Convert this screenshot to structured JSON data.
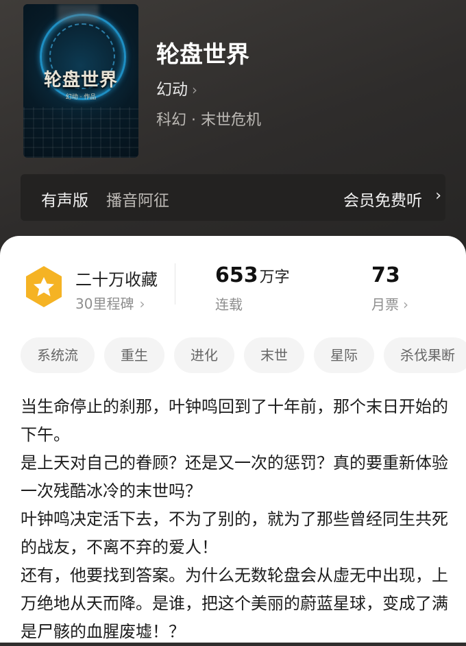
{
  "book": {
    "cover_title": "轮盘世界",
    "cover_author_line": "幻动 · 作品",
    "title": "轮盘世界",
    "author": "幻动",
    "author_chevron": "›",
    "genre": "科幻 · 末世危机"
  },
  "audio": {
    "label": "有声版",
    "narrator": "播音阿征",
    "free_listen": "会员免费听",
    "chevron": "›"
  },
  "stats": {
    "collection": "二十万收藏",
    "milestone": "30里程碑",
    "milestone_chevron": "›",
    "word_count": "653",
    "word_unit": "万字",
    "status": "连载",
    "monthly_votes": "73",
    "monthly_label": "月票",
    "monthly_chevron": "›",
    "badge_icon": "star-icon",
    "badge_color": "#f5b324"
  },
  "tags": [
    "系统流",
    "重生",
    "进化",
    "末世",
    "星际",
    "杀伐果断"
  ],
  "synopsis": [
    "当生命停止的刹那，叶钟鸣回到了十年前，那个末日开始的下午。",
    "是上天对自己的眷顾？还是又一次的惩罚？真的要重新体验一次残酷冰冷的末世吗？",
    "叶钟鸣决定活下去，不为了别的，就为了那些曾经同生共死的战友，不离不弃的爱人！",
    "还有，他要找到答案。为什么无数轮盘会从虚无中出现，上万绝地从天而降。是谁，把这个美丽的蔚蓝星球，变成了满是尸骸的血腥废墟！？"
  ]
}
